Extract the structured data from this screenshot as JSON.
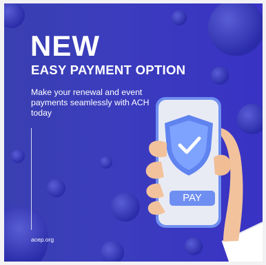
{
  "headline": "NEW",
  "subheadline": "EASY PAYMENT OPTION",
  "description": "Make your renewal and event payments seamlessly with  ACH today",
  "phone": {
    "button_label": "PAY",
    "icons": [
      "shield-check-icon"
    ]
  },
  "footer": {
    "website": "acep.org"
  },
  "colors": {
    "background": "#3a3cbc",
    "text": "#ffffff",
    "accent_blue": "#5b86f0",
    "phone_body": "#e9ebf4",
    "hand_skin": "#f2c29c"
  }
}
